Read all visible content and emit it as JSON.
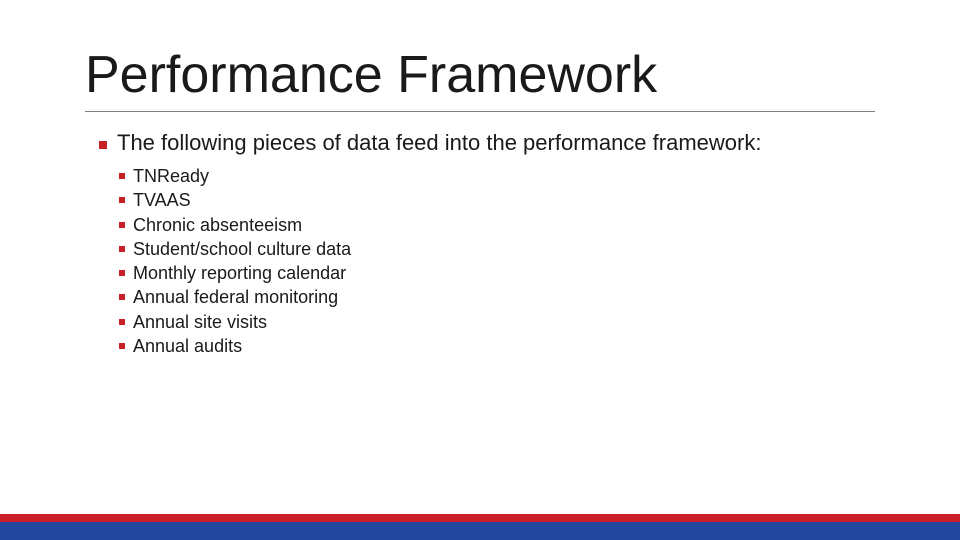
{
  "title": "Performance Framework",
  "main_item": "The following pieces of data feed into the performance framework:",
  "sub_items": [
    "TNReady",
    "TVAAS",
    "Chronic absenteeism",
    "Student/school culture data",
    "Monthly reporting calendar",
    "Annual federal monitoring",
    "Annual site visits",
    "Annual audits"
  ],
  "colors": {
    "accent": "#cb2027",
    "footer_blue": "#23469e"
  }
}
